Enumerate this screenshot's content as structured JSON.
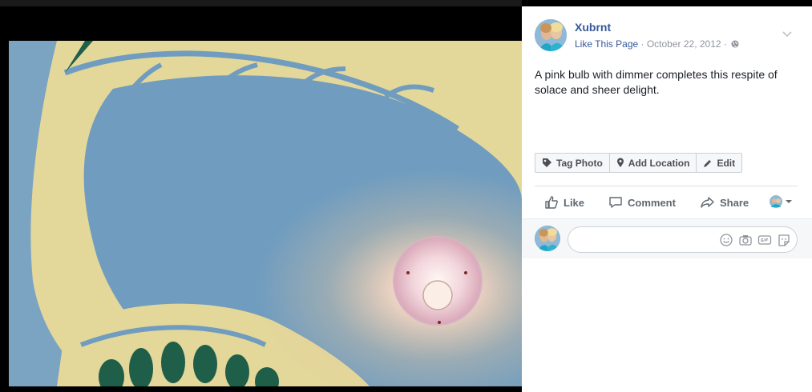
{
  "post": {
    "author": "Xubrnt",
    "like_page": "Like This Page",
    "separator": " · ",
    "date": "October 22, 2012",
    "text": "A pink bulb with dimmer completes this respite of solace and sheer delight."
  },
  "photo_actions": {
    "tag": "Tag Photo",
    "location": "Add Location",
    "edit": "Edit"
  },
  "actions": {
    "like": "Like",
    "comment": "Comment",
    "share": "Share"
  },
  "comment": {
    "placeholder": ""
  },
  "colors": {
    "link": "#365899",
    "meta": "#90949c",
    "ceiling_blue": "#6f9cbf",
    "ceiling_yellow": "#e3d79a",
    "leaf_green": "#1f5e48"
  }
}
